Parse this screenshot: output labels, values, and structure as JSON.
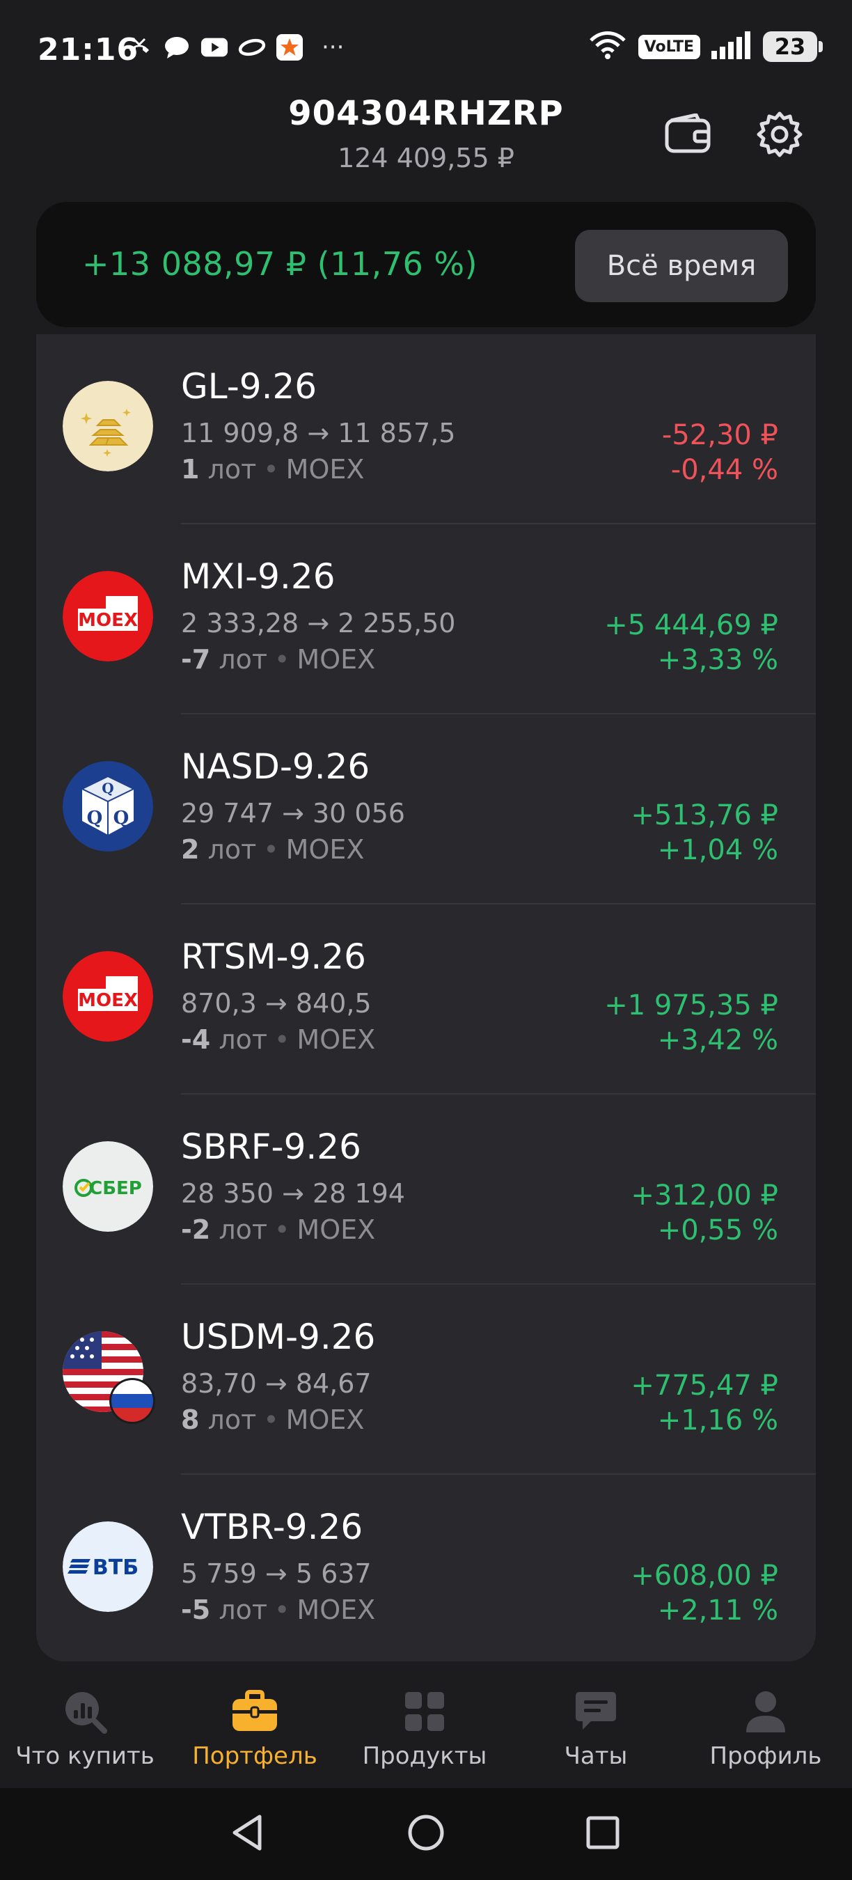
{
  "status_bar": {
    "time": "21:16",
    "more": "···",
    "volte": "VoLTE",
    "battery": "23"
  },
  "header": {
    "account_name": "904304RHZRP",
    "total_value": "124 409,55 ₽"
  },
  "summary": {
    "profit": "+13 088,97 ₽ (11,76 %)",
    "period_button": "Всё время"
  },
  "positions": [
    {
      "ticker": "GL-9.26",
      "price_from": "11 909,8",
      "price_to": "11 857,5",
      "lots": "1",
      "lots_unit": "лот",
      "exchange": "MOEX",
      "pnl": "-52,30 ₽",
      "pct": "-0,44 %",
      "direction": "negative",
      "logo": "gold-bars-logo"
    },
    {
      "ticker": "MXI-9.26",
      "price_from": "2 333,28",
      "price_to": "2 255,50",
      "lots": "-7",
      "lots_unit": "лот",
      "exchange": "MOEX",
      "pnl": "+5 444,69 ₽",
      "pct": "+3,33 %",
      "direction": "positive",
      "logo": "moex-logo"
    },
    {
      "ticker": "NASD-9.26",
      "price_from": "29 747",
      "price_to": "30 056",
      "lots": "2",
      "lots_unit": "лот",
      "exchange": "MOEX",
      "pnl": "+513,76 ₽",
      "pct": "+1,04 %",
      "direction": "positive",
      "logo": "nasdaq-qqq-logo"
    },
    {
      "ticker": "RTSM-9.26",
      "price_from": "870,3",
      "price_to": "840,5",
      "lots": "-4",
      "lots_unit": "лот",
      "exchange": "MOEX",
      "pnl": "+1 975,35 ₽",
      "pct": "+3,42 %",
      "direction": "positive",
      "logo": "moex-logo"
    },
    {
      "ticker": "SBRF-9.26",
      "price_from": "28 350",
      "price_to": "28 194",
      "lots": "-2",
      "lots_unit": "лот",
      "exchange": "MOEX",
      "pnl": "+312,00 ₽",
      "pct": "+0,55 %",
      "direction": "positive",
      "logo": "sber-logo"
    },
    {
      "ticker": "USDM-9.26",
      "price_from": "83,70",
      "price_to": "84,67",
      "lots": "8",
      "lots_unit": "лот",
      "exchange": "MOEX",
      "pnl": "+775,47 ₽",
      "pct": "+1,16 %",
      "direction": "positive",
      "logo": "usd-rub-flags-logo"
    },
    {
      "ticker": "VTBR-9.26",
      "price_from": "5 759",
      "price_to": "5 637",
      "lots": "-5",
      "lots_unit": "лот",
      "exchange": "MOEX",
      "pnl": "+608,00 ₽",
      "pct": "+2,11 %",
      "direction": "positive",
      "logo": "vtb-logo"
    }
  ],
  "logo_text": {
    "moex": "MOEX",
    "sber": "СБЕР",
    "vtb": "ВТБ",
    "q": "Q"
  },
  "bottom_nav": [
    {
      "label": "Что купить",
      "icon": "chart-search-icon",
      "active": false
    },
    {
      "label": "Портфель",
      "icon": "briefcase-icon",
      "active": true
    },
    {
      "label": "Продукты",
      "icon": "grid-icon",
      "active": false
    },
    {
      "label": "Чаты",
      "icon": "chat-icon",
      "active": false
    },
    {
      "label": "Профиль",
      "icon": "person-icon",
      "active": false
    }
  ],
  "colors": {
    "positive": "#2fbf71",
    "negative": "#f0525a",
    "accent": "#f7b12d",
    "background": "#1c1c1e",
    "card": "#28282d"
  }
}
